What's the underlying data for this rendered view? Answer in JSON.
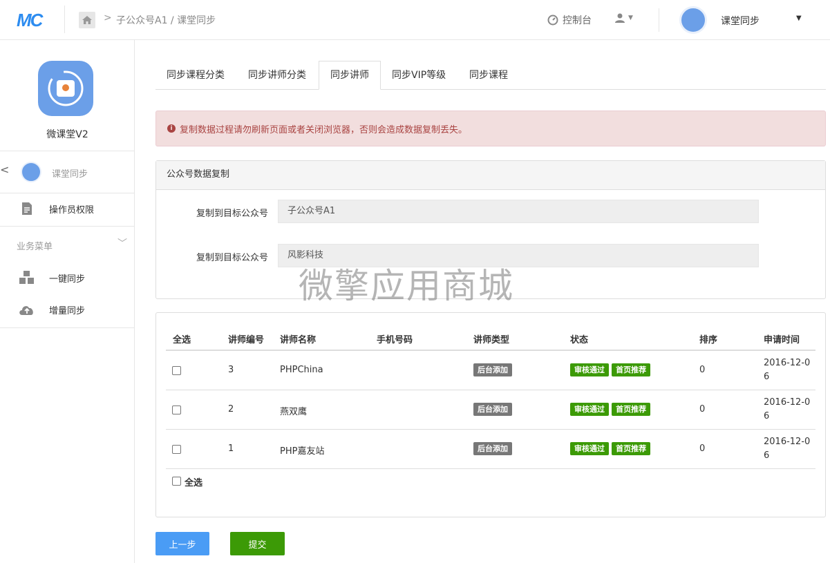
{
  "header": {
    "logo_text": "MC",
    "breadcrumb": "子公众号A1 / 课堂同步",
    "console_label": "控制台",
    "account_name": "课堂同步"
  },
  "sidebar": {
    "app_name": "微课堂V2",
    "current_module": "课堂同步",
    "operator_permissions": "操作员权限",
    "section_title": "业务菜单",
    "items": [
      {
        "label": "一键同步",
        "icon": "cubes-icon"
      },
      {
        "label": "增量同步",
        "icon": "cloud-upload-icon"
      }
    ]
  },
  "tabs": [
    {
      "label": "同步课程分类",
      "active": false
    },
    {
      "label": "同步讲师分类",
      "active": false
    },
    {
      "label": "同步讲师",
      "active": true
    },
    {
      "label": "同步VIP等级",
      "active": false
    },
    {
      "label": "同步课程",
      "active": false
    }
  ],
  "alert": {
    "text": "复制数据过程请勿刷新页面或者关闭浏览器，否则会造成数据复制丢失。"
  },
  "copy_panel": {
    "title": "公众号数据复制",
    "rows": [
      {
        "label": "复制到目标公众号",
        "value": "子公众号A1"
      },
      {
        "label": "复制到目标公众号",
        "value": "风影科技"
      }
    ]
  },
  "table": {
    "headers": [
      "全选",
      "讲师编号",
      "讲师名称",
      "手机号码",
      "讲师类型",
      "状态",
      "排序",
      "申请时间"
    ],
    "rows": [
      {
        "id": "3",
        "name": "PHPChina",
        "phone": "",
        "type": "后台添加",
        "status": [
          "审核通过",
          "首页推荐"
        ],
        "sort": "0",
        "time": "2016-12-06"
      },
      {
        "id": "2",
        "name": "燕双鹰",
        "phone": "",
        "type": "后台添加",
        "status": [
          "审核通过",
          "首页推荐"
        ],
        "sort": "0",
        "time": "2016-12-06"
      },
      {
        "id": "1",
        "name": "PHP嘉友站",
        "phone": "",
        "type": "后台添加",
        "status": [
          "审核通过",
          "首页推荐"
        ],
        "sort": "0",
        "time": "2016-12-06"
      }
    ],
    "select_all_label": "全选"
  },
  "buttons": {
    "prev": "上一步",
    "submit": "提交"
  },
  "watermark": "微擎应用商城",
  "colors": {
    "primary": "#4a9cf5",
    "success": "#3c9a06",
    "alert_bg": "#f2dede",
    "alert_text": "#a94442"
  }
}
